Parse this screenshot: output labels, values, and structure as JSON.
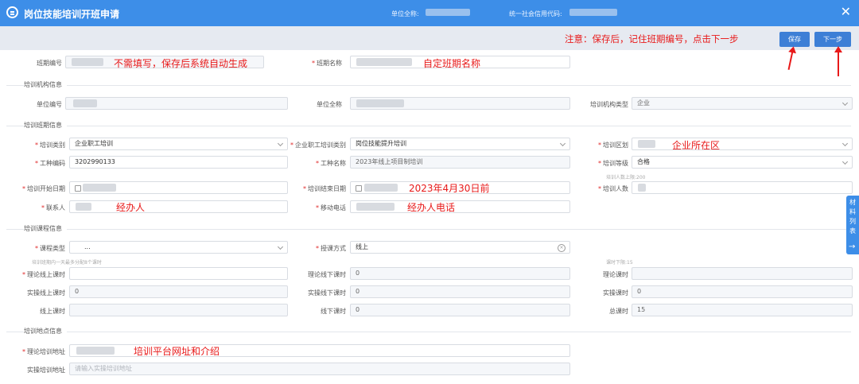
{
  "header": {
    "title": "岗位技能培训开班申请",
    "unit_name_label": "单位全称:",
    "credit_code_label": "统一社会信用代码:"
  },
  "toolbar": {
    "notice": "注意：保存后，记住班期编号，点击下一步",
    "save_label": "保存",
    "next_label": "下一步"
  },
  "sections": {
    "institution": "培训机构信息",
    "period": "培训班期信息",
    "course": "培训课程信息",
    "location": "培训地点信息"
  },
  "form": {
    "class_no_label": "班期编号",
    "class_name_label": "班期名称",
    "unit_code_label": "单位编号",
    "unit_fullname_label": "单位全称",
    "inst_type_label": "培训机构类型",
    "inst_type_value": "企业",
    "train_category_label": "培训类别",
    "train_category_value": "企业职工培训",
    "staff_category_label": "企业职工培训类别",
    "staff_category_value": "岗位技能提升培训",
    "district_label": "培训区划",
    "job_code_label": "工种编码",
    "job_code_value": "3202990133",
    "job_name_label": "工种名称",
    "job_name_value": "2023年线上项目制培训",
    "train_level_label": "培训等级",
    "train_level_value": "合格",
    "max_people_hint": "培训人数上限:200",
    "start_date_label": "培训开始日期",
    "end_date_label": "培训结束日期",
    "people_label": "培训人数",
    "contact_label": "联系人",
    "mobile_label": "移动电话",
    "course_type_label": "课程类型",
    "course_type_value": "...",
    "teach_mode_label": "授课方式",
    "teach_mode_value": "线上",
    "hint_day_hours": "培训班期内一天最多分配8个课时",
    "hint_hours_limit": "课时下限:15",
    "theory_online_label": "理论线上课时",
    "theory_offline_label": "理论线下课时",
    "theory_offline_value": "0",
    "theory_hours_label": "理论课时",
    "practice_online_label": "实操线上课时",
    "practice_online_value": "0",
    "practice_offline_label": "实操线下课时",
    "practice_offline_value": "0",
    "practice_hours_label": "实操课时",
    "practice_hours_value": "0",
    "online_hours_label": "线上课时",
    "offline_hours_label": "线下课时",
    "offline_hours_value": "0",
    "total_hours_label": "总课时",
    "total_hours_value": "15",
    "theory_addr_label": "理论培训地址",
    "practice_addr_label": "实操培训地址",
    "practice_addr_placeholder": "请输入实操培训地址"
  },
  "annotations": {
    "class_no": "不需填写，保存后系统自动生成",
    "class_name": "自定班期名称",
    "district": "企业所在区",
    "end_date": "2023年4月30日前",
    "contact": "经办人",
    "mobile": "经办人电话",
    "address": "培训平台网址和介绍"
  },
  "side_tab": {
    "label": [
      "材",
      "料",
      "列",
      "表"
    ],
    "arrow": "→"
  },
  "colors": {
    "header": "#3d8ee8",
    "button": "#3d7fd6",
    "annotation": "#e81919"
  }
}
